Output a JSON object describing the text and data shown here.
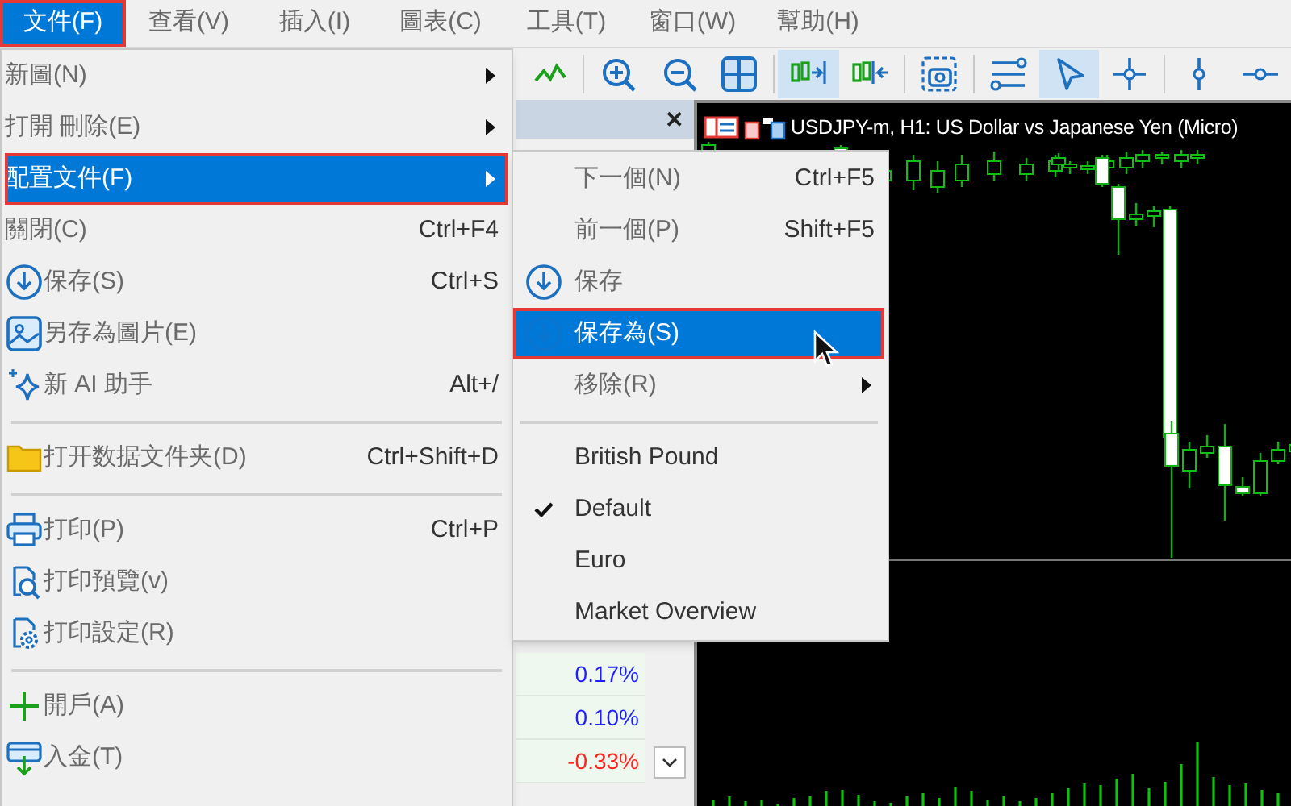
{
  "menu_bar": [
    {
      "label": "文件(F)",
      "selected": true
    },
    {
      "label": "查看(V)",
      "selected": false
    },
    {
      "label": "插入(I)",
      "selected": false
    },
    {
      "label": "圖表(C)",
      "selected": false
    },
    {
      "label": "工具(T)",
      "selected": false
    },
    {
      "label": "窗口(W)",
      "selected": false
    },
    {
      "label": "幫助(H)",
      "selected": false
    }
  ],
  "toolbar": [
    {
      "kind": "button",
      "selected": false
    },
    {
      "kind": "separator"
    },
    {
      "kind": "button",
      "selected": false
    },
    {
      "kind": "button",
      "selected": false
    },
    {
      "kind": "button",
      "selected": false
    },
    {
      "kind": "separator"
    },
    {
      "kind": "button",
      "selected": true
    },
    {
      "kind": "button",
      "selected": false
    },
    {
      "kind": "separator"
    },
    {
      "kind": "button",
      "selected": false
    },
    {
      "kind": "separator"
    },
    {
      "kind": "button",
      "selected": false
    },
    {
      "kind": "button",
      "selected": true
    },
    {
      "kind": "button",
      "selected": false
    },
    {
      "kind": "separator"
    },
    {
      "kind": "button",
      "selected": false
    },
    {
      "kind": "button",
      "selected": false
    }
  ],
  "market_watch": {
    "close": "✕",
    "rows": [
      {
        "change": "0.17%",
        "color": "#1e1eff"
      },
      {
        "change": "0.10%",
        "color": "#1e1eff"
      },
      {
        "change": "-0.33%",
        "color": "#ff2020"
      }
    ]
  },
  "chart": {
    "title": "USDJPY-m, H1:  US Dollar vs Japanese Yen (Micro)"
  },
  "file_menu": [
    {
      "kind": "item",
      "label": "新圖(N)",
      "submenu": true,
      "selected": false
    },
    {
      "kind": "item",
      "label": "打開 刪除(E)",
      "submenu": true,
      "selected": false
    },
    {
      "kind": "item",
      "label": "配置文件(F)",
      "submenu": true,
      "selected": true
    },
    {
      "kind": "item",
      "label": "關閉(C)",
      "shortcut": "Ctrl+F4",
      "submenu": false,
      "selected": false
    },
    {
      "kind": "item",
      "label": "保存(S)",
      "shortcut": "Ctrl+S",
      "submenu": false,
      "selected": false
    },
    {
      "kind": "item",
      "label": "另存為圖片(E)",
      "submenu": false,
      "selected": false
    },
    {
      "kind": "item",
      "label": "新 AI 助手",
      "shortcut": "Alt+/",
      "submenu": false,
      "selected": false
    },
    {
      "kind": "separator"
    },
    {
      "kind": "item",
      "label": "打开数据文件夹(D)",
      "shortcut": "Ctrl+Shift+D",
      "submenu": false,
      "selected": false
    },
    {
      "kind": "separator"
    },
    {
      "kind": "item",
      "label": "打印(P)",
      "shortcut": "Ctrl+P",
      "submenu": false,
      "selected": false
    },
    {
      "kind": "item",
      "label": "打印預覽(v)",
      "submenu": false,
      "selected": false
    },
    {
      "kind": "item",
      "label": "打印設定(R)",
      "submenu": false,
      "selected": false
    },
    {
      "kind": "separator"
    },
    {
      "kind": "item",
      "label": "開戶(A)",
      "submenu": false,
      "selected": false
    },
    {
      "kind": "item",
      "label": "入金(T)",
      "submenu": false,
      "selected": false
    }
  ],
  "profiles_submenu": [
    {
      "kind": "item",
      "label": "下一個(N)",
      "shortcut": "Ctrl+F5",
      "submenu": false,
      "selected": false,
      "checked": false
    },
    {
      "kind": "item",
      "label": "前一個(P)",
      "shortcut": "Shift+F5",
      "submenu": false,
      "selected": false,
      "checked": false
    },
    {
      "kind": "item",
      "label": "保存",
      "submenu": false,
      "selected": false,
      "checked": false
    },
    {
      "kind": "item",
      "label": "保存為(S)",
      "submenu": false,
      "selected": true,
      "checked": false
    },
    {
      "kind": "item",
      "label": "移除(R)",
      "submenu": true,
      "selected": false,
      "checked": false
    },
    {
      "kind": "separator"
    },
    {
      "kind": "item",
      "label": "British Pound",
      "submenu": false,
      "selected": false,
      "checked": false
    },
    {
      "kind": "item",
      "label": "Default",
      "submenu": false,
      "selected": false,
      "checked": true
    },
    {
      "kind": "item",
      "label": "Euro",
      "submenu": false,
      "selected": false,
      "checked": false
    },
    {
      "kind": "item",
      "label": "Market Overview",
      "submenu": false,
      "selected": false,
      "checked": false
    }
  ]
}
